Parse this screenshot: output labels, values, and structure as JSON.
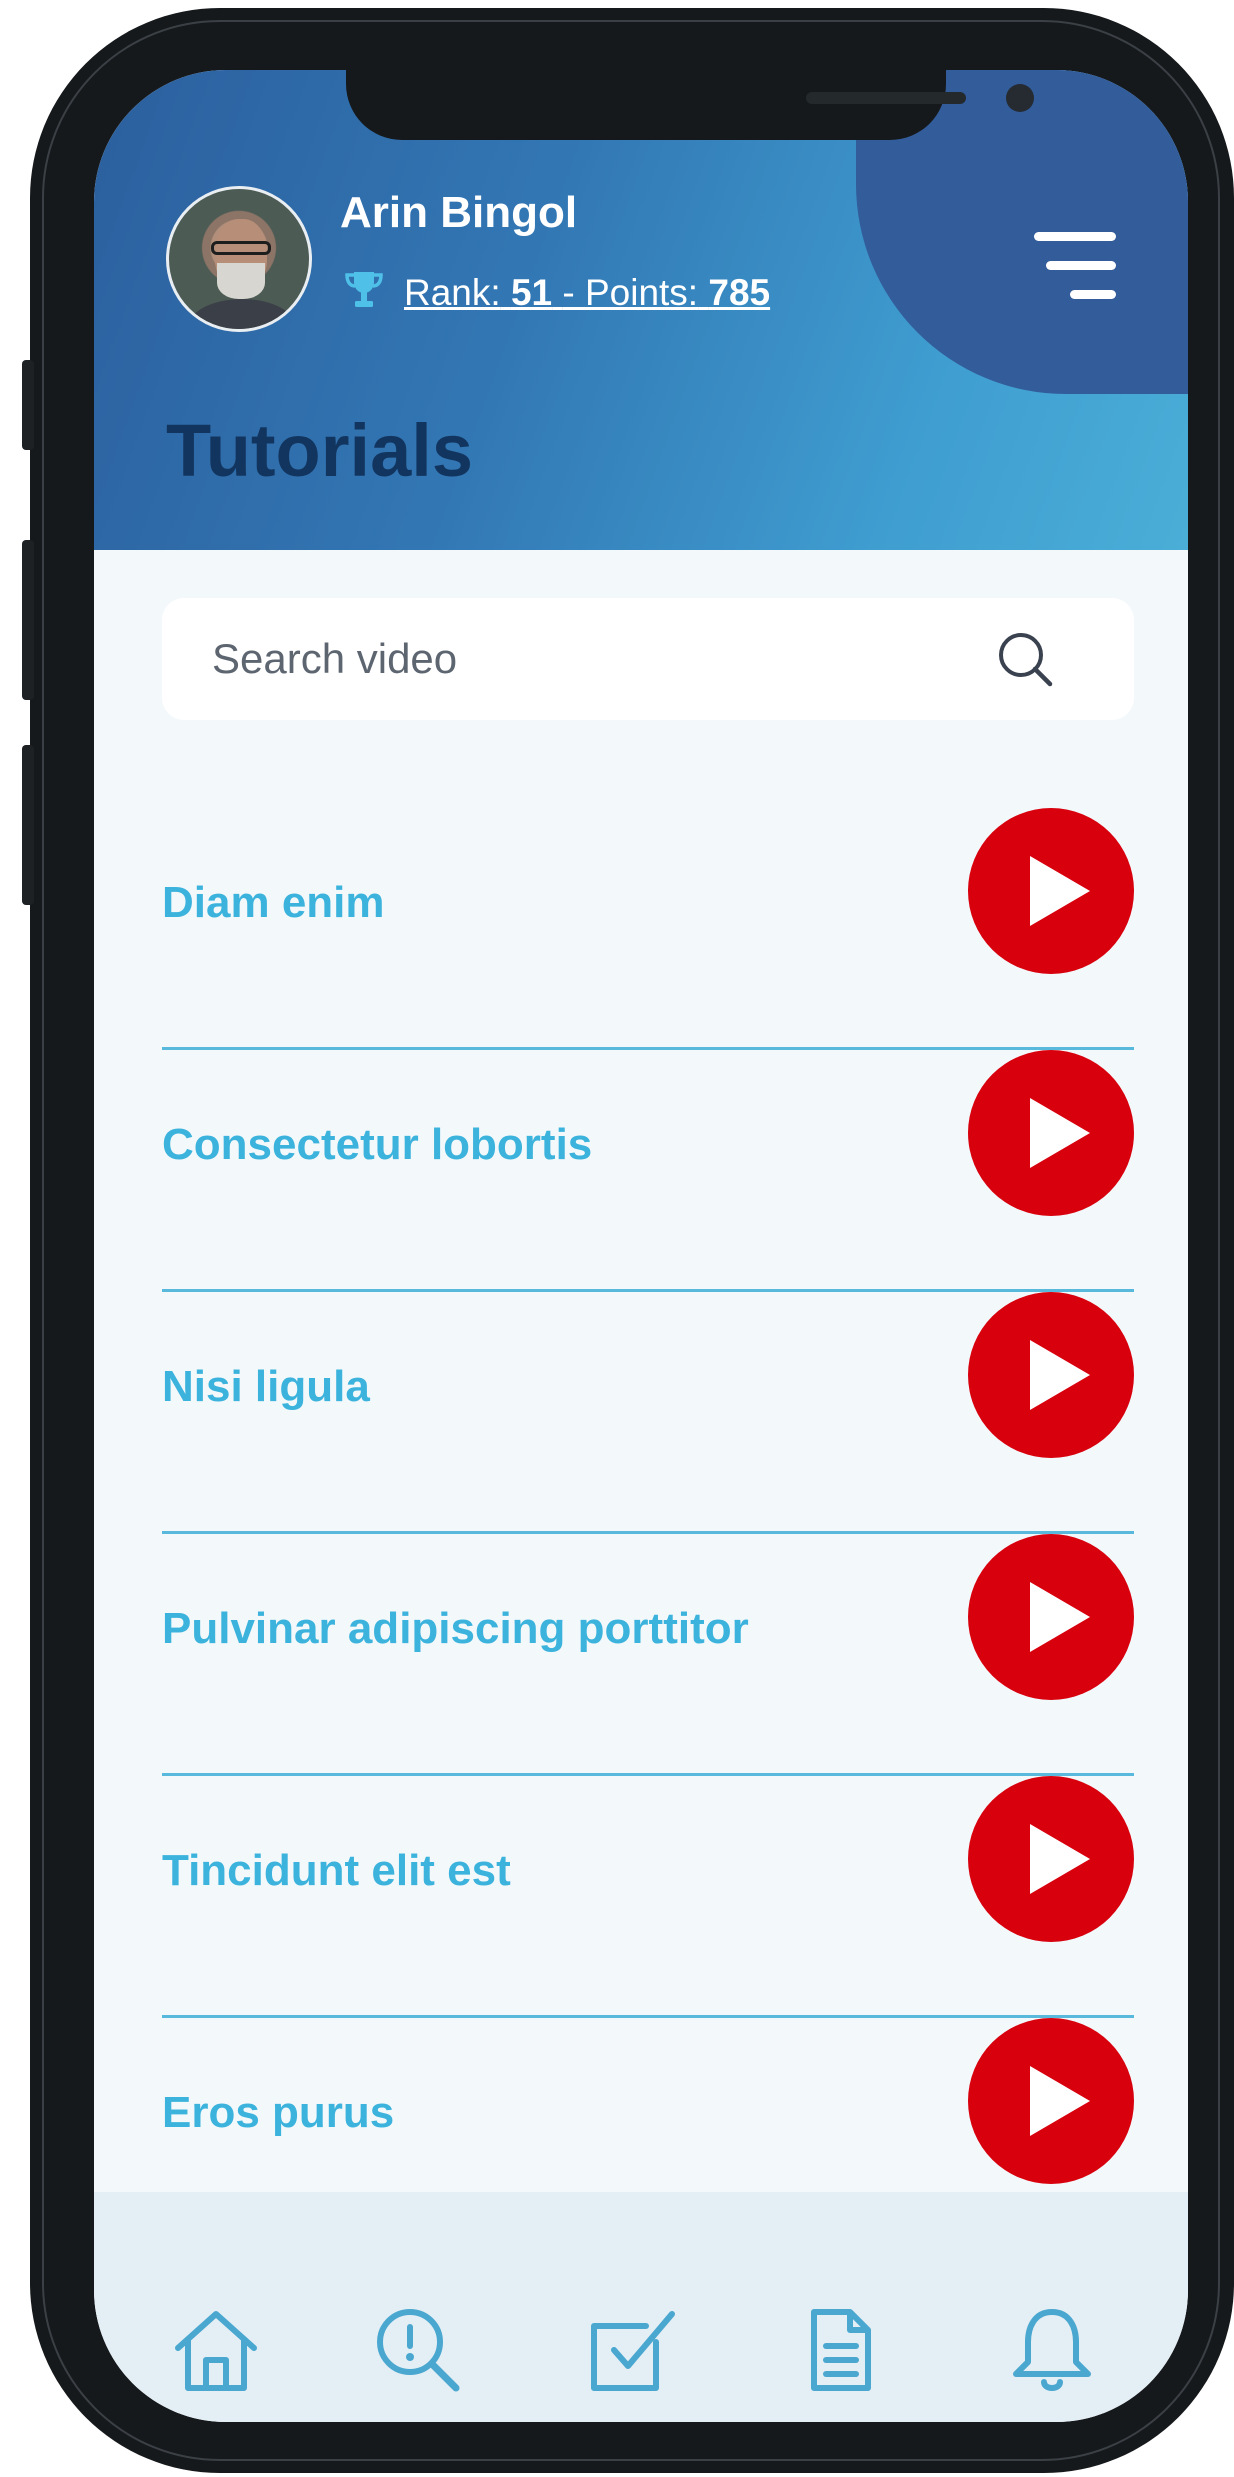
{
  "user": {
    "name": "Arin Bingol",
    "rank_label": "Rank:",
    "rank_value": "51",
    "separator": "- Points:",
    "points_value": "785"
  },
  "page": {
    "title": "Tutorials"
  },
  "search": {
    "placeholder": "Search video",
    "value": ""
  },
  "videos": [
    {
      "title": "Diam enim"
    },
    {
      "title": "Consectetur lobortis"
    },
    {
      "title": "Nisi ligula"
    },
    {
      "title": "Pulvinar adipiscing porttitor"
    },
    {
      "title": "Tincidunt elit est"
    },
    {
      "title": "Eros purus"
    }
  ],
  "bottom_nav": [
    {
      "icon": "home-icon"
    },
    {
      "icon": "search-alert-icon"
    },
    {
      "icon": "checkbox-icon"
    },
    {
      "icon": "document-icon"
    },
    {
      "icon": "bell-icon"
    }
  ],
  "colors": {
    "header_blue": "#2c5f9e",
    "accent_cyan": "#3cb3dc",
    "play_red": "#d8000d",
    "title_navy": "#12355f",
    "nav_icon": "#4aa7cf"
  }
}
